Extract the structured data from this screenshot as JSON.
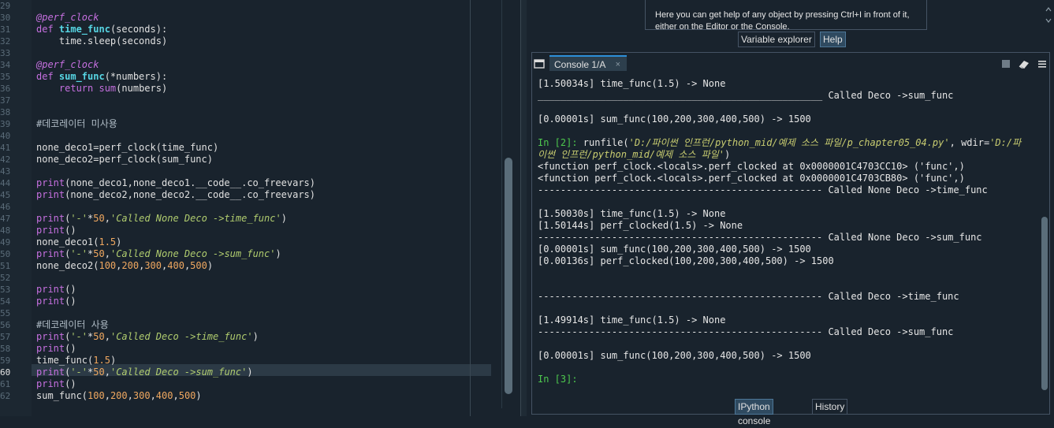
{
  "editor": {
    "current_line": 60,
    "line_numbers": [
      "29",
      "30",
      "31",
      "32",
      "33",
      "34",
      "35",
      "36",
      "37",
      "38",
      "39",
      "40",
      "41",
      "42",
      "43",
      "44",
      "45",
      "46",
      "47",
      "48",
      "49",
      "50",
      "51",
      "52",
      "53",
      "54",
      "55",
      "56",
      "57",
      "58",
      "59",
      "60",
      "61",
      "62"
    ],
    "lines": [
      {
        "n": "29",
        "parts": []
      },
      {
        "n": "30",
        "parts": [
          {
            "c": "dec",
            "t": "@perf_clock"
          }
        ]
      },
      {
        "n": "31",
        "parts": [
          {
            "c": "kw",
            "t": "def "
          },
          {
            "c": "fn",
            "t": "time_func"
          },
          {
            "c": "",
            "t": "(seconds):"
          }
        ]
      },
      {
        "n": "32",
        "parts": [
          {
            "c": "",
            "t": "    time.sleep(seconds)"
          }
        ]
      },
      {
        "n": "33",
        "parts": []
      },
      {
        "n": "34",
        "parts": [
          {
            "c": "dec",
            "t": "@perf_clock"
          }
        ]
      },
      {
        "n": "35",
        "parts": [
          {
            "c": "kw",
            "t": "def "
          },
          {
            "c": "fn",
            "t": "sum_func"
          },
          {
            "c": "",
            "t": "(*numbers):"
          }
        ]
      },
      {
        "n": "36",
        "parts": [
          {
            "c": "",
            "t": "    "
          },
          {
            "c": "kw",
            "t": "return "
          },
          {
            "c": "builtin",
            "t": "sum"
          },
          {
            "c": "",
            "t": "(numbers)"
          }
        ]
      },
      {
        "n": "37",
        "parts": []
      },
      {
        "n": "38",
        "parts": []
      },
      {
        "n": "39",
        "parts": [
          {
            "c": "cm",
            "t": "#데코레이터 미사용"
          }
        ]
      },
      {
        "n": "40",
        "parts": []
      },
      {
        "n": "41",
        "parts": [
          {
            "c": "",
            "t": "none_deco1=perf_clock(time_func)"
          }
        ]
      },
      {
        "n": "42",
        "parts": [
          {
            "c": "",
            "t": "none_deco2=perf_clock(sum_func)"
          }
        ]
      },
      {
        "n": "43",
        "parts": []
      },
      {
        "n": "44",
        "parts": [
          {
            "c": "builtin",
            "t": "print"
          },
          {
            "c": "",
            "t": "(none_deco1,none_deco1.__code__.co_freevars)"
          }
        ]
      },
      {
        "n": "45",
        "parts": [
          {
            "c": "builtin",
            "t": "print"
          },
          {
            "c": "",
            "t": "(none_deco2,none_deco2.__code__.co_freevars)"
          }
        ]
      },
      {
        "n": "46",
        "parts": []
      },
      {
        "n": "47",
        "parts": [
          {
            "c": "builtin",
            "t": "print"
          },
          {
            "c": "",
            "t": "("
          },
          {
            "c": "str",
            "t": "'-'"
          },
          {
            "c": "",
            "t": "*"
          },
          {
            "c": "num",
            "t": "50"
          },
          {
            "c": "",
            "t": ","
          },
          {
            "c": "str",
            "t": "'Called None Deco ->time_func'"
          },
          {
            "c": "",
            "t": ")"
          }
        ]
      },
      {
        "n": "48",
        "parts": [
          {
            "c": "builtin",
            "t": "print"
          },
          {
            "c": "",
            "t": "()"
          }
        ]
      },
      {
        "n": "49",
        "parts": [
          {
            "c": "",
            "t": "none_deco1("
          },
          {
            "c": "num",
            "t": "1.5"
          },
          {
            "c": "",
            "t": ")"
          }
        ]
      },
      {
        "n": "50",
        "parts": [
          {
            "c": "builtin",
            "t": "print"
          },
          {
            "c": "",
            "t": "("
          },
          {
            "c": "str",
            "t": "'-'"
          },
          {
            "c": "",
            "t": "*"
          },
          {
            "c": "num",
            "t": "50"
          },
          {
            "c": "",
            "t": ","
          },
          {
            "c": "str",
            "t": "'Called None Deco ->sum_func'"
          },
          {
            "c": "",
            "t": ")"
          }
        ]
      },
      {
        "n": "51",
        "parts": [
          {
            "c": "",
            "t": "none_deco2("
          },
          {
            "c": "num",
            "t": "100"
          },
          {
            "c": "",
            "t": ","
          },
          {
            "c": "num",
            "t": "200"
          },
          {
            "c": "",
            "t": ","
          },
          {
            "c": "num",
            "t": "300"
          },
          {
            "c": "",
            "t": ","
          },
          {
            "c": "num",
            "t": "400"
          },
          {
            "c": "",
            "t": ","
          },
          {
            "c": "num",
            "t": "500"
          },
          {
            "c": "",
            "t": ")"
          }
        ]
      },
      {
        "n": "52",
        "parts": []
      },
      {
        "n": "53",
        "parts": [
          {
            "c": "builtin",
            "t": "print"
          },
          {
            "c": "",
            "t": "()"
          }
        ]
      },
      {
        "n": "54",
        "parts": [
          {
            "c": "builtin",
            "t": "print"
          },
          {
            "c": "",
            "t": "()"
          }
        ]
      },
      {
        "n": "55",
        "parts": []
      },
      {
        "n": "56",
        "parts": [
          {
            "c": "cm",
            "t": "#데코레이터 사용"
          }
        ]
      },
      {
        "n": "57",
        "parts": [
          {
            "c": "builtin",
            "t": "print"
          },
          {
            "c": "",
            "t": "("
          },
          {
            "c": "str",
            "t": "'-'"
          },
          {
            "c": "",
            "t": "*"
          },
          {
            "c": "num",
            "t": "50"
          },
          {
            "c": "",
            "t": ","
          },
          {
            "c": "str",
            "t": "'Called Deco ->time_func'"
          },
          {
            "c": "",
            "t": ")"
          }
        ]
      },
      {
        "n": "58",
        "parts": [
          {
            "c": "builtin",
            "t": "print"
          },
          {
            "c": "",
            "t": "()"
          }
        ]
      },
      {
        "n": "59",
        "parts": [
          {
            "c": "",
            "t": "time_func("
          },
          {
            "c": "num",
            "t": "1.5"
          },
          {
            "c": "",
            "t": ")"
          }
        ]
      },
      {
        "n": "60",
        "parts": [
          {
            "c": "builtin",
            "t": "print"
          },
          {
            "c": "",
            "t": "("
          },
          {
            "c": "str",
            "t": "'-'"
          },
          {
            "c": "",
            "t": "*"
          },
          {
            "c": "num",
            "t": "50"
          },
          {
            "c": "",
            "t": ","
          },
          {
            "c": "str",
            "t": "'Called Deco ->sum_func'"
          },
          {
            "c": "",
            "t": ")"
          }
        ]
      },
      {
        "n": "61",
        "parts": [
          {
            "c": "builtin",
            "t": "print"
          },
          {
            "c": "",
            "t": "()"
          }
        ]
      },
      {
        "n": "62",
        "parts": [
          {
            "c": "",
            "t": "sum_func("
          },
          {
            "c": "num",
            "t": "100"
          },
          {
            "c": "",
            "t": ","
          },
          {
            "c": "num",
            "t": "200"
          },
          {
            "c": "",
            "t": ","
          },
          {
            "c": "num",
            "t": "300"
          },
          {
            "c": "",
            "t": ","
          },
          {
            "c": "num",
            "t": "400"
          },
          {
            "c": "",
            "t": ","
          },
          {
            "c": "num",
            "t": "500"
          },
          {
            "c": "",
            "t": ")"
          }
        ]
      }
    ]
  },
  "help": {
    "text_line1": "Here you can get help of any object by pressing Ctrl+I in front of it,",
    "text_line2": "either on the Editor or the Console."
  },
  "top_tabs": {
    "variable_explorer": "Variable explorer",
    "help": "Help"
  },
  "console": {
    "tab_label": "Console 1/A",
    "close_icon": "×",
    "lines": [
      {
        "parts": [
          {
            "c": "",
            "t": "[1.50034s] time_func(1.5) -> None"
          }
        ]
      },
      {
        "parts": [
          {
            "c": "",
            "t": "__________________________________________________ Called Deco ->sum_func"
          }
        ]
      },
      {
        "parts": []
      },
      {
        "parts": [
          {
            "c": "",
            "t": "[0.00001s] sum_func(100,200,300,400,500) -> 1500"
          }
        ]
      },
      {
        "parts": []
      },
      {
        "parts": [
          {
            "c": "prompt",
            "t": "In [2]: "
          },
          {
            "c": "",
            "t": "runfile("
          },
          {
            "c": "cstr",
            "t": "'D:/파이썬 인프런/python_mid/예제 소스 파일/p_chapter05_04.py'"
          },
          {
            "c": "",
            "t": ", wdir="
          },
          {
            "c": "cstr",
            "t": "'D:/파"
          }
        ]
      },
      {
        "parts": [
          {
            "c": "cstr",
            "t": "이썬 인프런/python_mid/예제 소스 파일'"
          },
          {
            "c": "",
            "t": ")"
          }
        ]
      },
      {
        "parts": [
          {
            "c": "",
            "t": "<function perf_clock.<locals>.perf_clocked at 0x0000001C4703CC10> ('func',)"
          }
        ]
      },
      {
        "parts": [
          {
            "c": "",
            "t": "<function perf_clock.<locals>.perf_clocked at 0x0000001C4703CB80> ('func',)"
          }
        ]
      },
      {
        "parts": [
          {
            "c": "",
            "t": "-------------------------------------------------- Called None Deco ->time_func"
          }
        ]
      },
      {
        "parts": []
      },
      {
        "parts": [
          {
            "c": "",
            "t": "[1.50030s] time_func(1.5) -> None"
          }
        ]
      },
      {
        "parts": [
          {
            "c": "",
            "t": "[1.50144s] perf_clocked(1.5) -> None"
          }
        ]
      },
      {
        "parts": [
          {
            "c": "",
            "t": "-------------------------------------------------- Called None Deco ->sum_func"
          }
        ]
      },
      {
        "parts": [
          {
            "c": "",
            "t": "[0.00001s] sum_func(100,200,300,400,500) -> 1500"
          }
        ]
      },
      {
        "parts": [
          {
            "c": "",
            "t": "[0.00136s] perf_clocked(100,200,300,400,500) -> 1500"
          }
        ]
      },
      {
        "parts": []
      },
      {
        "parts": []
      },
      {
        "parts": [
          {
            "c": "",
            "t": "-------------------------------------------------- Called Deco ->time_func"
          }
        ]
      },
      {
        "parts": []
      },
      {
        "parts": [
          {
            "c": "",
            "t": "[1.49914s] time_func(1.5) -> None"
          }
        ]
      },
      {
        "parts": [
          {
            "c": "",
            "t": "-------------------------------------------------- Called Deco ->sum_func"
          }
        ]
      },
      {
        "parts": []
      },
      {
        "parts": [
          {
            "c": "",
            "t": "[0.00001s] sum_func(100,200,300,400,500) -> 1500"
          }
        ]
      },
      {
        "parts": []
      },
      {
        "parts": [
          {
            "c": "prompt",
            "t": "In [3]: "
          }
        ]
      }
    ]
  },
  "bottom_tabs": {
    "ipython_console": "IPython console",
    "history": "History"
  }
}
